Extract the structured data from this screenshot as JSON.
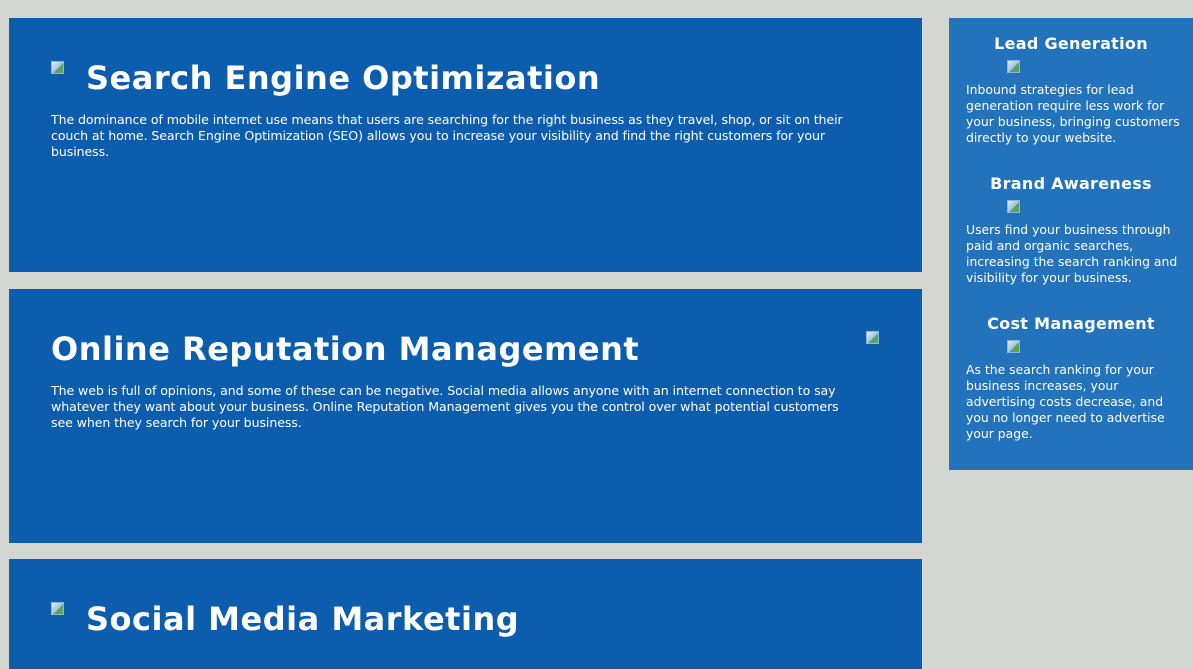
{
  "panels": {
    "seo": {
      "title": "Search Engine Optimization",
      "text": "The dominance of mobile internet use means that users are searching for the right business as they travel, shop, or sit on their couch at home. Search Engine Optimization (SEO) allows you to increase your visibility and find the right customers for your business."
    },
    "orm": {
      "title": "Online Reputation Management",
      "text": "The web is full of opinions, and some of these can be negative. Social media allows anyone with an internet connection to say whatever they want about your business. Online Reputation Management gives you the control over what potential customers see when they search for your business."
    },
    "smm": {
      "title": "Social Media Marketing"
    }
  },
  "sidebar": {
    "lead": {
      "title": "Lead Generation",
      "text": "Inbound strategies for lead generation require less work for your business, bringing customers directly to your website."
    },
    "brand": {
      "title": "Brand Awareness",
      "text": "Users find your business through paid and organic searches, increasing the search ranking and visibility for your business."
    },
    "cost": {
      "title": "Cost Management",
      "text": "As the search ranking for your business increases, your advertising costs decrease, and you no longer need to advertise your page."
    }
  },
  "colors": {
    "page_background": "#d4d6d1",
    "panel_background": "#0c5dae",
    "sidebar_background": "#2273bb",
    "text": "#ffffff"
  },
  "icons": {
    "image_placeholder": "broken-image-icon"
  }
}
